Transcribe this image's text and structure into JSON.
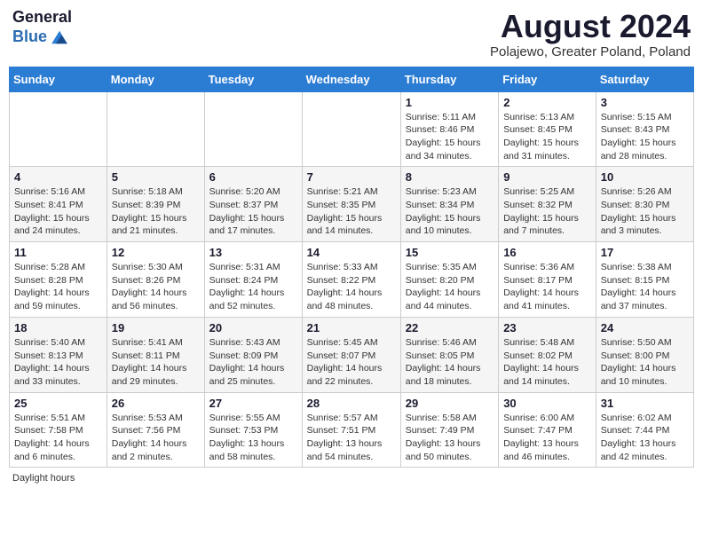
{
  "header": {
    "logo_general": "General",
    "logo_blue": "Blue",
    "month_year": "August 2024",
    "location": "Polajewo, Greater Poland, Poland"
  },
  "days_of_week": [
    "Sunday",
    "Monday",
    "Tuesday",
    "Wednesday",
    "Thursday",
    "Friday",
    "Saturday"
  ],
  "weeks": [
    [
      {
        "day": "",
        "detail": ""
      },
      {
        "day": "",
        "detail": ""
      },
      {
        "day": "",
        "detail": ""
      },
      {
        "day": "",
        "detail": ""
      },
      {
        "day": "1",
        "detail": "Sunrise: 5:11 AM\nSunset: 8:46 PM\nDaylight: 15 hours\nand 34 minutes."
      },
      {
        "day": "2",
        "detail": "Sunrise: 5:13 AM\nSunset: 8:45 PM\nDaylight: 15 hours\nand 31 minutes."
      },
      {
        "day": "3",
        "detail": "Sunrise: 5:15 AM\nSunset: 8:43 PM\nDaylight: 15 hours\nand 28 minutes."
      }
    ],
    [
      {
        "day": "4",
        "detail": "Sunrise: 5:16 AM\nSunset: 8:41 PM\nDaylight: 15 hours\nand 24 minutes."
      },
      {
        "day": "5",
        "detail": "Sunrise: 5:18 AM\nSunset: 8:39 PM\nDaylight: 15 hours\nand 21 minutes."
      },
      {
        "day": "6",
        "detail": "Sunrise: 5:20 AM\nSunset: 8:37 PM\nDaylight: 15 hours\nand 17 minutes."
      },
      {
        "day": "7",
        "detail": "Sunrise: 5:21 AM\nSunset: 8:35 PM\nDaylight: 15 hours\nand 14 minutes."
      },
      {
        "day": "8",
        "detail": "Sunrise: 5:23 AM\nSunset: 8:34 PM\nDaylight: 15 hours\nand 10 minutes."
      },
      {
        "day": "9",
        "detail": "Sunrise: 5:25 AM\nSunset: 8:32 PM\nDaylight: 15 hours\nand 7 minutes."
      },
      {
        "day": "10",
        "detail": "Sunrise: 5:26 AM\nSunset: 8:30 PM\nDaylight: 15 hours\nand 3 minutes."
      }
    ],
    [
      {
        "day": "11",
        "detail": "Sunrise: 5:28 AM\nSunset: 8:28 PM\nDaylight: 14 hours\nand 59 minutes."
      },
      {
        "day": "12",
        "detail": "Sunrise: 5:30 AM\nSunset: 8:26 PM\nDaylight: 14 hours\nand 56 minutes."
      },
      {
        "day": "13",
        "detail": "Sunrise: 5:31 AM\nSunset: 8:24 PM\nDaylight: 14 hours\nand 52 minutes."
      },
      {
        "day": "14",
        "detail": "Sunrise: 5:33 AM\nSunset: 8:22 PM\nDaylight: 14 hours\nand 48 minutes."
      },
      {
        "day": "15",
        "detail": "Sunrise: 5:35 AM\nSunset: 8:20 PM\nDaylight: 14 hours\nand 44 minutes."
      },
      {
        "day": "16",
        "detail": "Sunrise: 5:36 AM\nSunset: 8:17 PM\nDaylight: 14 hours\nand 41 minutes."
      },
      {
        "day": "17",
        "detail": "Sunrise: 5:38 AM\nSunset: 8:15 PM\nDaylight: 14 hours\nand 37 minutes."
      }
    ],
    [
      {
        "day": "18",
        "detail": "Sunrise: 5:40 AM\nSunset: 8:13 PM\nDaylight: 14 hours\nand 33 minutes."
      },
      {
        "day": "19",
        "detail": "Sunrise: 5:41 AM\nSunset: 8:11 PM\nDaylight: 14 hours\nand 29 minutes."
      },
      {
        "day": "20",
        "detail": "Sunrise: 5:43 AM\nSunset: 8:09 PM\nDaylight: 14 hours\nand 25 minutes."
      },
      {
        "day": "21",
        "detail": "Sunrise: 5:45 AM\nSunset: 8:07 PM\nDaylight: 14 hours\nand 22 minutes."
      },
      {
        "day": "22",
        "detail": "Sunrise: 5:46 AM\nSunset: 8:05 PM\nDaylight: 14 hours\nand 18 minutes."
      },
      {
        "day": "23",
        "detail": "Sunrise: 5:48 AM\nSunset: 8:02 PM\nDaylight: 14 hours\nand 14 minutes."
      },
      {
        "day": "24",
        "detail": "Sunrise: 5:50 AM\nSunset: 8:00 PM\nDaylight: 14 hours\nand 10 minutes."
      }
    ],
    [
      {
        "day": "25",
        "detail": "Sunrise: 5:51 AM\nSunset: 7:58 PM\nDaylight: 14 hours\nand 6 minutes."
      },
      {
        "day": "26",
        "detail": "Sunrise: 5:53 AM\nSunset: 7:56 PM\nDaylight: 14 hours\nand 2 minutes."
      },
      {
        "day": "27",
        "detail": "Sunrise: 5:55 AM\nSunset: 7:53 PM\nDaylight: 13 hours\nand 58 minutes."
      },
      {
        "day": "28",
        "detail": "Sunrise: 5:57 AM\nSunset: 7:51 PM\nDaylight: 13 hours\nand 54 minutes."
      },
      {
        "day": "29",
        "detail": "Sunrise: 5:58 AM\nSunset: 7:49 PM\nDaylight: 13 hours\nand 50 minutes."
      },
      {
        "day": "30",
        "detail": "Sunrise: 6:00 AM\nSunset: 7:47 PM\nDaylight: 13 hours\nand 46 minutes."
      },
      {
        "day": "31",
        "detail": "Sunrise: 6:02 AM\nSunset: 7:44 PM\nDaylight: 13 hours\nand 42 minutes."
      }
    ]
  ],
  "footer": {
    "daylight_label": "Daylight hours"
  }
}
